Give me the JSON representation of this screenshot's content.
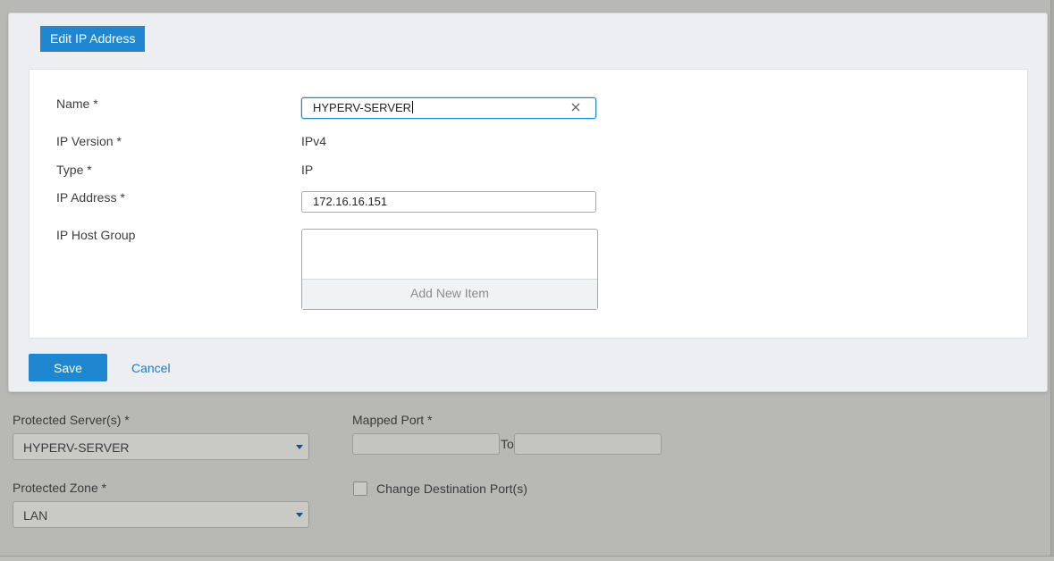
{
  "modal": {
    "title": "Edit IP Address",
    "fields": {
      "name_label": "Name *",
      "name_value": "HYPERV-SERVER",
      "ip_version_label": "IP Version *",
      "ip_version_value": "IPv4",
      "type_label": "Type *",
      "type_value": "IP",
      "ip_address_label": "IP Address *",
      "ip_address_value": "172.16.16.151",
      "ip_host_group_label": "IP Host Group",
      "add_new_item": "Add New Item"
    },
    "save_label": "Save",
    "cancel_label": "Cancel"
  },
  "background_form": {
    "protected_servers_label": "Protected Server(s) *",
    "protected_servers_value": "HYPERV-SERVER",
    "mapped_port_label": "Mapped Port *",
    "to_label": "To",
    "protected_zone_label": "Protected Zone *",
    "protected_zone_value": "LAN",
    "change_destination_label": "Change Destination Port(s)"
  },
  "colors": {
    "accent": "#1f86d0",
    "link": "#1f7cc2",
    "overlay_bg": "#b8b8b4"
  },
  "icons": {
    "clear": "close-icon",
    "dropdown": "caret-down-icon"
  }
}
